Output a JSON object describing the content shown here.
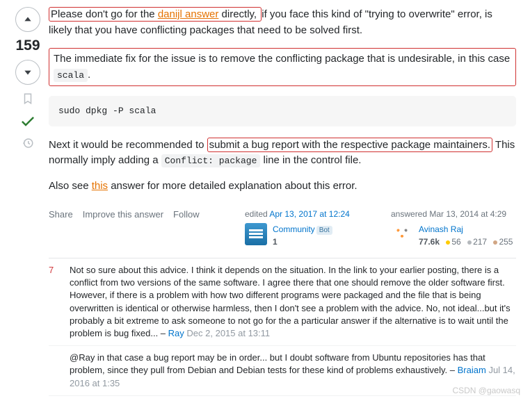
{
  "vote": {
    "score": "159"
  },
  "answer": {
    "p1": {
      "hl1": "Please don't go for the ",
      "link1": "danijl answer",
      "hl1b": " directly, ",
      "rest": "if you face this kind of \"trying to overwrite\" error, is likely that you have conflicting packages that need to be solved first."
    },
    "p2": {
      "text": "The immediate fix for the issue is to remove the conflicting package that is undesirable, in this case ",
      "code": "scala",
      "tail": "."
    },
    "codeblock": "sudo dpkg -P scala",
    "p3": {
      "pre": "Next it would be recommended to ",
      "hl": "submit a bug report with the respective package maintainers.",
      "post1": " This normally imply adding a ",
      "code": "Conflict: package",
      "post2": " line in the control file."
    },
    "p4": {
      "pre": "Also see ",
      "link": "this",
      "post": " answer for more detailed explanation about this error."
    }
  },
  "actions": {
    "share": "Share",
    "improve": "Improve this answer",
    "follow": "Follow"
  },
  "editor": {
    "label": "edited ",
    "time": "Apr 13, 2017 at 12:24",
    "name": "Community",
    "bot": "Bot",
    "rep": "1"
  },
  "author": {
    "label": "answered Mar 13, 2014 at 4:29",
    "name": "Avinash Raj",
    "rep": "77.6k",
    "gold": "56",
    "silver": "217",
    "bronze": "255"
  },
  "comments": [
    {
      "score": "7",
      "body": "Not so sure about this advice. I think it depends on the situation. In the link to your earlier posting, there is a conflict from two versions of the same software. I agree there that one should remove the older software first. However, if there is a problem with how two different programs were packaged and the file that is being overwritten is identical or otherwise harmless, then I don't see a problem with the advice. No, not ideal...but it's probably a bit extreme to ask someone to not go for the a particular answer if the alternative is to wait until the problem is bug fixed...",
      "user": "Ray",
      "time": "Dec 2, 2015 at 13:11"
    },
    {
      "score": "",
      "body": "@Ray in that case a bug report may be in order... but I doubt software from Ubuntu repositories has that problem, since they pull from Debian and Debian tests for these kind of problems exhaustively.",
      "user": "Braiam",
      "time": "Jul 14, 2016 at 1:35"
    }
  ],
  "watermark": "CSDN @gaowasq"
}
